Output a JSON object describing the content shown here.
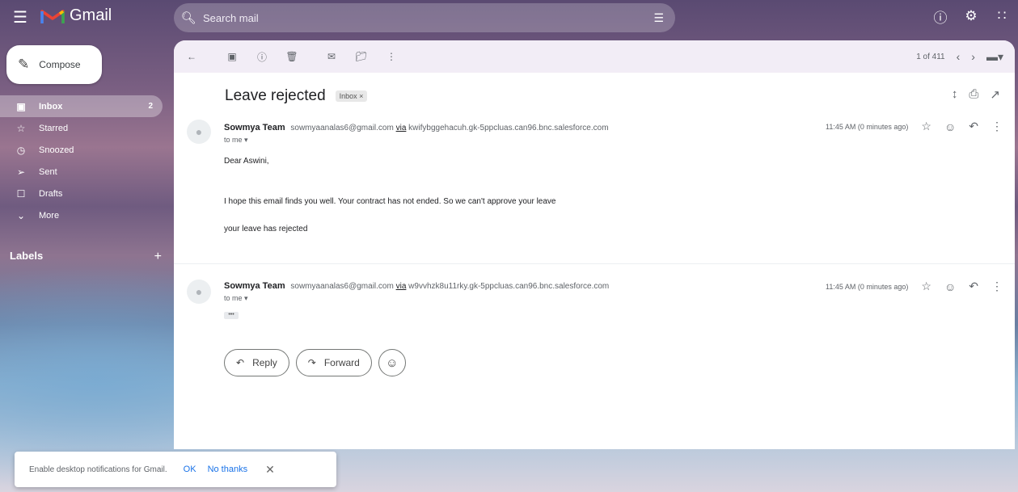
{
  "app": {
    "name": "Gmail"
  },
  "search": {
    "placeholder": "Search mail"
  },
  "sidebar": {
    "compose_label": "Compose",
    "items": [
      {
        "label": "Inbox",
        "count": "2",
        "icon": "inbox-icon"
      },
      {
        "label": "Starred",
        "icon": "star-icon"
      },
      {
        "label": "Snoozed",
        "icon": "clock-icon"
      },
      {
        "label": "Sent",
        "icon": "send-icon"
      },
      {
        "label": "Drafts",
        "icon": "draft-icon"
      },
      {
        "label": "More",
        "icon": "chevron-down-icon"
      }
    ],
    "labels_heading": "Labels"
  },
  "toolbar": {
    "pagination": "1 of 411"
  },
  "thread": {
    "subject": "Leave rejected",
    "label_chip": "Inbox ×",
    "messages": [
      {
        "sender_name": "Sowmya Team",
        "sender_email": "sowmyaanalas6@gmail.com",
        "via_label": "via",
        "via_domain": "kwifybggehacuh.gk-5ppcluas.can96.bnc.salesforce.com",
        "to": "to me",
        "time": "11:45 AM (0 minutes ago)",
        "greeting": "Dear Aswini,",
        "paragraph1": "I hope this email finds you well. Your contract has not ended. So we can't approve your leave",
        "paragraph2": "your leave has rejected"
      },
      {
        "sender_name": "Sowmya Team",
        "sender_email": "sowmyaanalas6@gmail.com",
        "via_label": "via",
        "via_domain": "w9vvhzk8u11rky.gk-5ppcluas.can96.bnc.salesforce.com",
        "to": "to me",
        "time": "11:45 AM (0 minutes ago)",
        "ellipsis": "•••"
      }
    ]
  },
  "actions": {
    "reply_label": "Reply",
    "forward_label": "Forward"
  },
  "notification": {
    "text": "Enable desktop notifications for Gmail.",
    "ok_label": "OK",
    "no_label": "No thanks"
  }
}
